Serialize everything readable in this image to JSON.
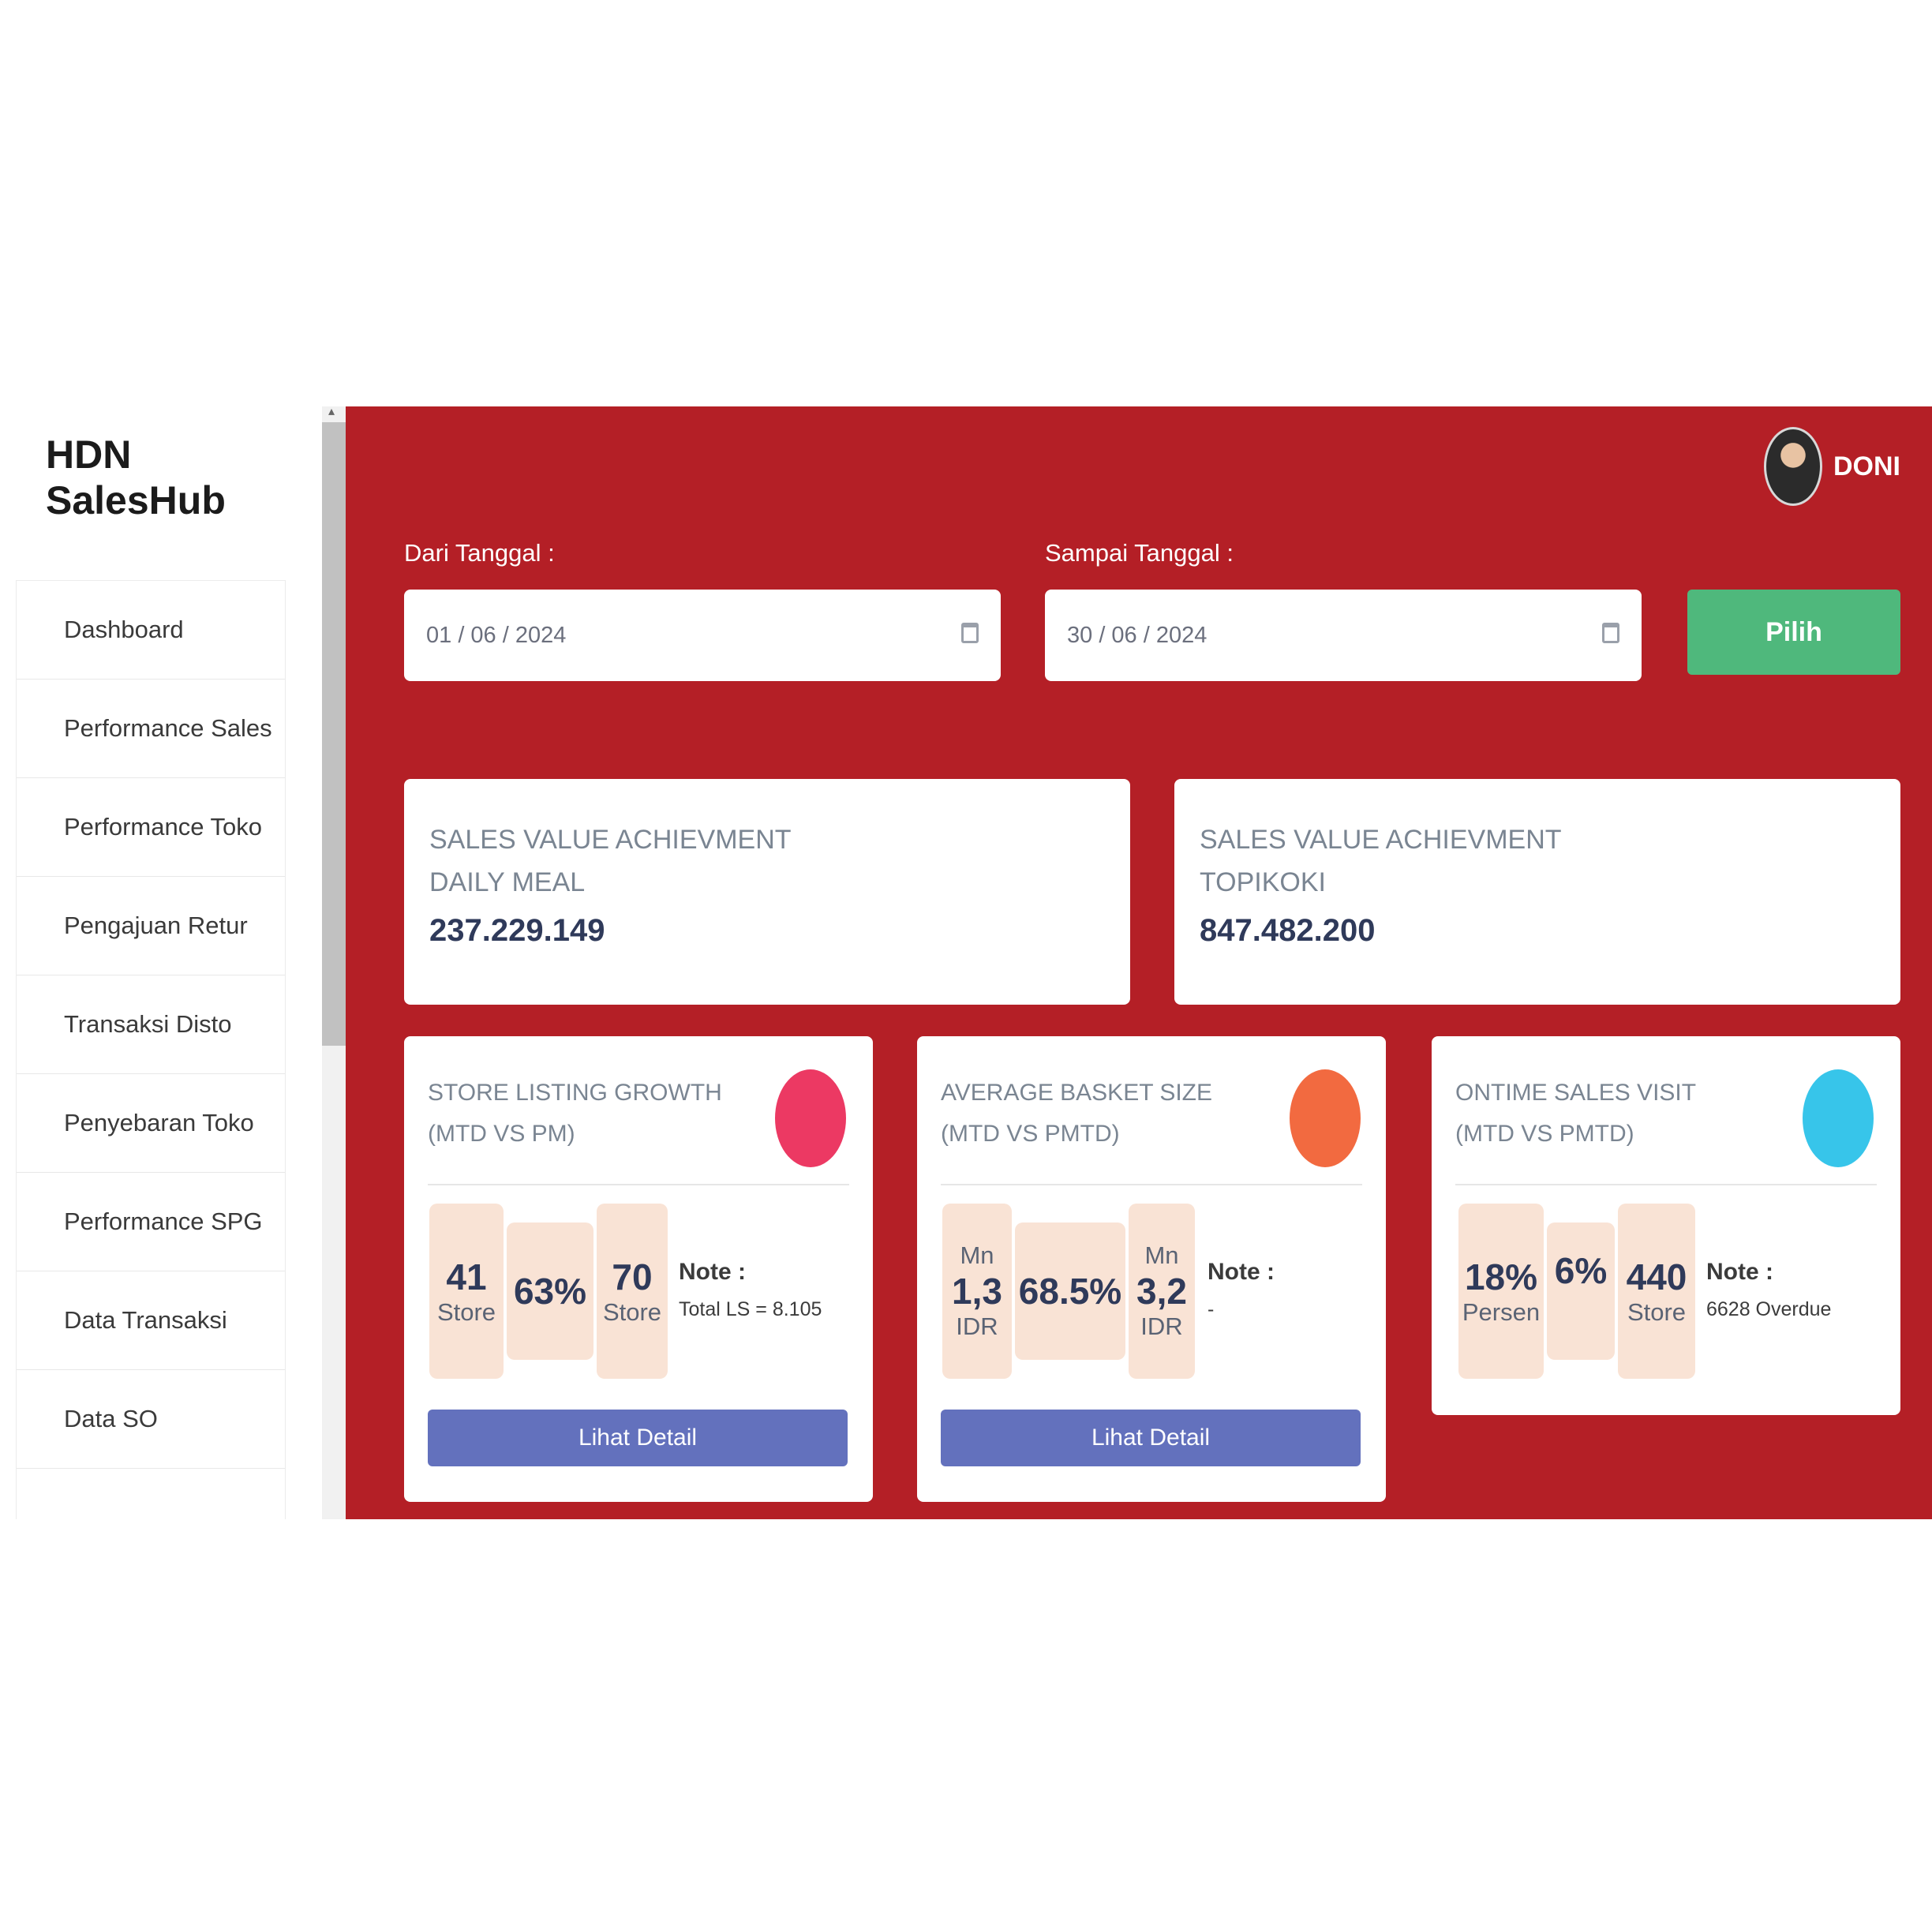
{
  "brand": "HDN SalesHub",
  "sidebar": {
    "items": [
      {
        "label": "Dashboard"
      },
      {
        "label": "Performance Sales"
      },
      {
        "label": "Performance Toko"
      },
      {
        "label": "Pengajuan Retur"
      },
      {
        "label": "Transaksi Disto"
      },
      {
        "label": "Penyebaran Toko"
      },
      {
        "label": "Performance SPG"
      },
      {
        "label": "Data Transaksi"
      },
      {
        "label": "Data SO"
      }
    ]
  },
  "user": {
    "name": "DONI"
  },
  "filter": {
    "from_label": "Dari Tanggal :",
    "from_value": "01 / 06 / 2024",
    "to_label": "Sampai Tanggal :",
    "to_value": "30 / 06 / 2024",
    "submit_label": "Pilih"
  },
  "sales_value": [
    {
      "title_line1": "SALES VALUE ACHIEVMENT",
      "title_line2": "DAILY MEAL",
      "value": "237.229.149"
    },
    {
      "title_line1": "SALES VALUE ACHIEVMENT",
      "title_line2": "TOPIKOKI",
      "value": "847.482.200"
    }
  ],
  "metrics": [
    {
      "title_line1": "STORE LISTING GROWTH",
      "title_line2": "(MTD VS PM)",
      "circle_color": "#ec3963",
      "left": {
        "top": "",
        "value": "41",
        "unit": "Store"
      },
      "middle": "63%",
      "right": {
        "top": "",
        "value": "70",
        "unit": "Store"
      },
      "note_label": "Note :",
      "note_text": "Total LS = 8.105",
      "button_label": "Lihat Detail"
    },
    {
      "title_line1": "AVERAGE BASKET SIZE",
      "title_line2": "(MTD VS PMTD)",
      "circle_color": "#f26a40",
      "left": {
        "top": "Mn",
        "value": "1,3",
        "unit": "IDR"
      },
      "middle": "68.5%",
      "right": {
        "top": "Mn",
        "value": "3,2",
        "unit": "IDR"
      },
      "note_label": "Note :",
      "note_text": "-",
      "button_label": "Lihat Detail"
    },
    {
      "title_line1": "ONTIME SALES VISIT",
      "title_line2": "(MTD VS PMTD)",
      "circle_color": "#37c5ea",
      "left": {
        "top": "",
        "value": "18%",
        "unit": "Persen"
      },
      "middle": "6%",
      "right": {
        "top": "",
        "value": "440",
        "unit": "Store"
      },
      "note_label": "Note :",
      "note_text": "6628 Overdue"
    }
  ]
}
